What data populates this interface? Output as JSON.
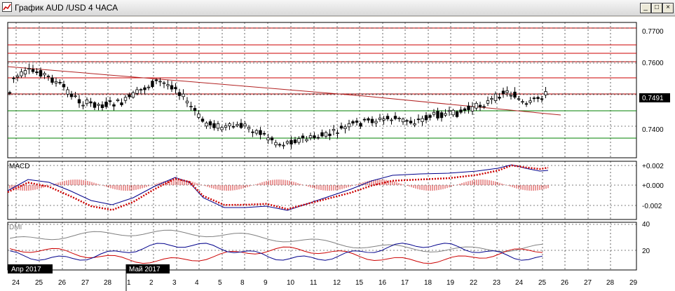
{
  "window": {
    "title": "График AUD /USD 4 ЧАСА",
    "buttons": {
      "minimize": "_",
      "maximize": "□",
      "close": "×"
    }
  },
  "price_axis": {
    "labels": [
      "0.7700",
      "0.7600",
      "0.7491",
      "0.7400"
    ],
    "current": "0.7491"
  },
  "macd": {
    "title": "MACD",
    "labels": [
      "+0.002",
      "+0.000",
      "-0.002"
    ]
  },
  "dmi": {
    "title": "DMI",
    "labels": [
      "40",
      "20"
    ]
  },
  "time_axis": {
    "days": [
      "24",
      "25",
      "26",
      "27",
      "28",
      "1",
      "2",
      "3",
      "4",
      "5",
      "8",
      "9",
      "10",
      "11",
      "12",
      "15",
      "16",
      "17",
      "18",
      "19",
      "22",
      "23",
      "24",
      "25",
      "26",
      "27",
      "28",
      "29"
    ],
    "month_markers": [
      "Апр 2017",
      "Май 2017"
    ]
  },
  "colors": {
    "bg": "#ffffff",
    "grid": "#000000",
    "candle": "#000000",
    "trendline": "#b22222",
    "resistance": "#cc0000",
    "support": "#008000",
    "macd_line": "#00008b",
    "signal": "#cc0000",
    "dmi_plus": "#cc0000",
    "dmi_minus": "#00008b",
    "adx": "#808080"
  }
}
